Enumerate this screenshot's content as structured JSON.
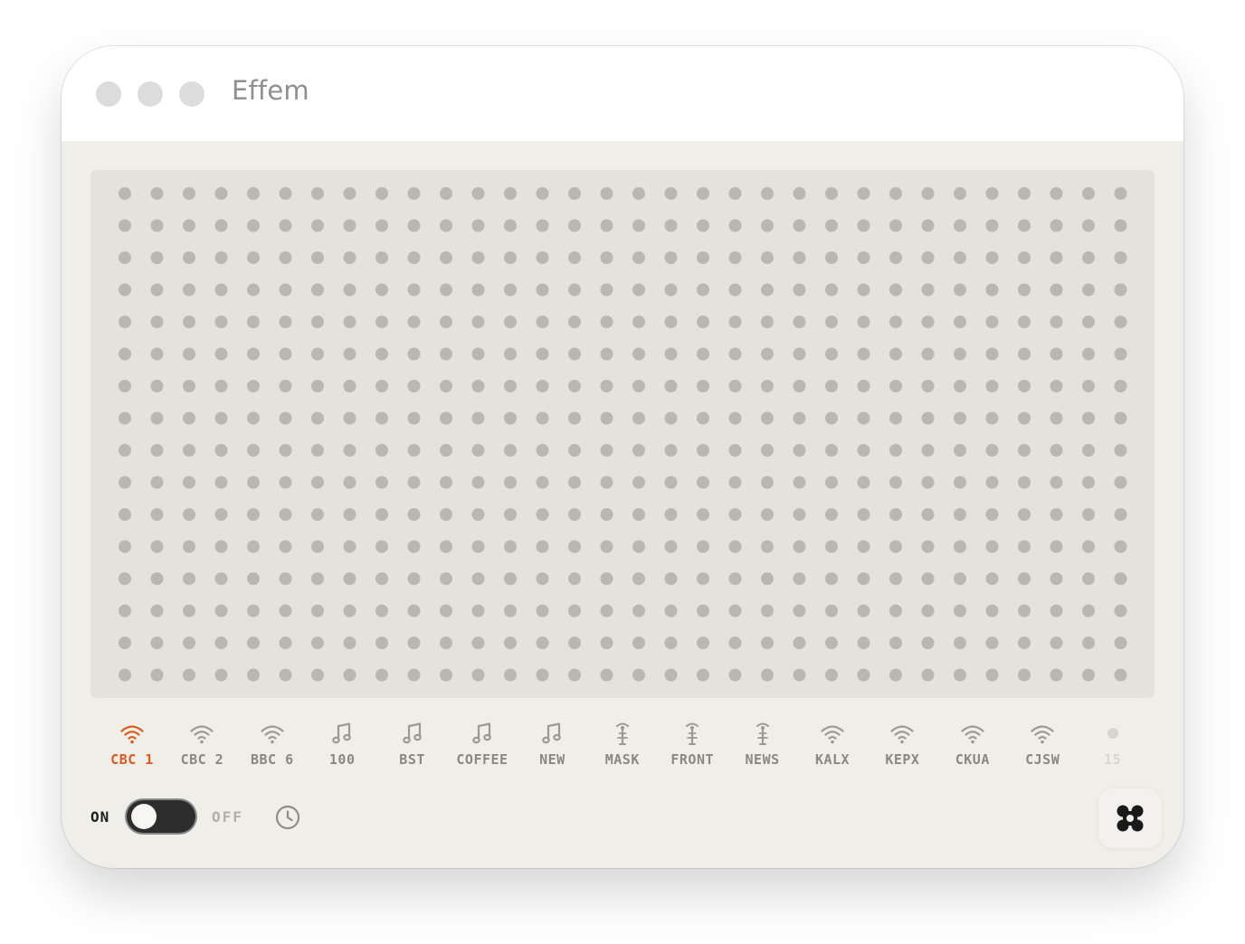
{
  "window": {
    "title": "Effem"
  },
  "display": {
    "rows": 16,
    "cols": 32,
    "dot_color": "#b9b7b1",
    "background": "#e4e2dd"
  },
  "presets": [
    {
      "label": "CBC 1",
      "icon": "wifi-icon",
      "active": true
    },
    {
      "label": "CBC 2",
      "icon": "wifi-icon",
      "active": false
    },
    {
      "label": "BBC 6",
      "icon": "wifi-icon",
      "active": false
    },
    {
      "label": "100",
      "icon": "music-note-icon",
      "active": false
    },
    {
      "label": "BST",
      "icon": "music-note-icon",
      "active": false
    },
    {
      "label": "COFFEE",
      "icon": "music-note-icon",
      "active": false
    },
    {
      "label": "NEW",
      "icon": "music-note-icon",
      "active": false
    },
    {
      "label": "MASK",
      "icon": "antenna-icon",
      "active": false
    },
    {
      "label": "FRONT",
      "icon": "antenna-icon",
      "active": false
    },
    {
      "label": "NEWS",
      "icon": "antenna-icon",
      "active": false
    },
    {
      "label": "KALX",
      "icon": "wifi-icon",
      "active": false
    },
    {
      "label": "KEPX",
      "icon": "wifi-icon",
      "active": false
    },
    {
      "label": "CKUA",
      "icon": "wifi-icon",
      "active": false
    },
    {
      "label": "CJSW",
      "icon": "wifi-icon",
      "active": false
    },
    {
      "label": "15",
      "icon": "dot-icon",
      "active": false,
      "empty": true
    }
  ],
  "power": {
    "on_label": "ON",
    "off_label": "OFF",
    "state": "on"
  },
  "icons": {
    "sleep_timer": "clock-icon",
    "app_menu": "four-petal-icon"
  },
  "colors": {
    "accent": "#dd5a1c",
    "label": "#8a8883",
    "window_bg": "#f0eee9"
  }
}
